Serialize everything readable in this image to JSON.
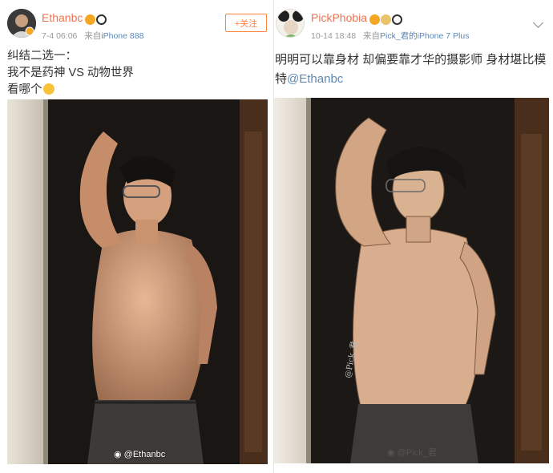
{
  "posts": [
    {
      "username": "Ethanbc",
      "time": "7-4 06:06",
      "source_prefix": "来自",
      "device": "iPhone 888",
      "follow_label": "+关注",
      "text_lines": [
        "纠结二选一：",
        "我不是药神 VS 动物世界",
        "看哪个"
      ],
      "watermark": "@Ethanbc",
      "badge_colors": [
        "#f5a623",
        "#333333"
      ],
      "icons": [
        "avatar",
        "vip-badge-icon",
        "panda-icon",
        "laugh-emoji-icon",
        "weibo-icon"
      ]
    },
    {
      "username": "PickPhobia",
      "time": "10-14 18:48",
      "source_prefix": "来自",
      "device": "Pick_君的iPhone 7 Plus",
      "text_line_1": "明明可以靠身材 却偏要靠才华的摄影师 身材堪比模",
      "text_line_2_prefix": "特",
      "mention": "@Ethanbc",
      "watermark": "@Pick_君",
      "badge_colors": [
        "#f5a623",
        "#e9c46a",
        "#333333"
      ],
      "icons": [
        "avatar",
        "vip-badge-icon",
        "crown-icon",
        "panda-icon",
        "chevron-down-icon",
        "weibo-icon"
      ]
    }
  ],
  "colors": {
    "username": "#eb7350",
    "link": "#5e87b2",
    "meta": "#999999",
    "follow": "#ff8140"
  }
}
